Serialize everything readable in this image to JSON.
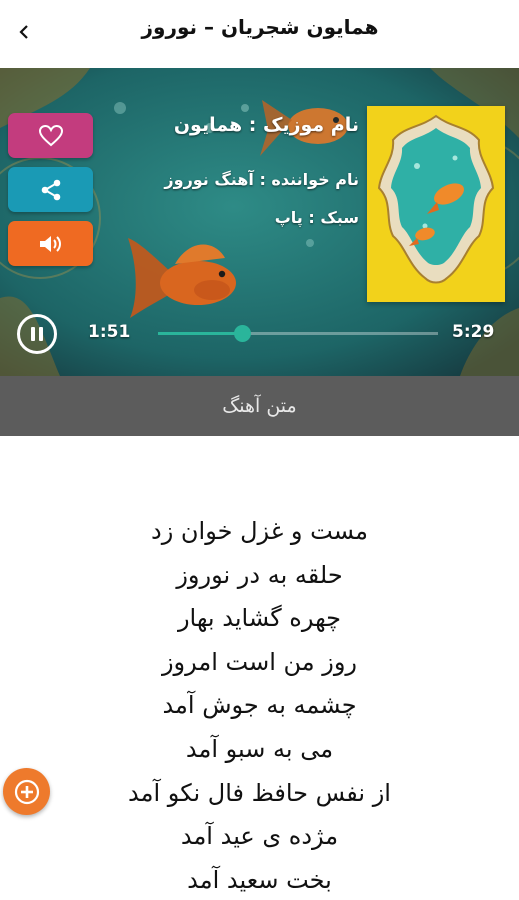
{
  "header": {
    "title": "همایون شجریان – نوروز",
    "back_icon": "chevron-left-icon"
  },
  "player": {
    "actions": [
      {
        "name": "like",
        "icon": "heart-icon",
        "color": "#c33c7e"
      },
      {
        "name": "share",
        "icon": "share-icon",
        "color": "#1a9ab5"
      },
      {
        "name": "volume",
        "icon": "speaker-icon",
        "color": "#ef6a22"
      }
    ],
    "info": {
      "music_name": "نام موزیک : همایون",
      "singer": "نام خواننده : آهنگ نوروز",
      "genre": "سبک : پاپ"
    },
    "time_current": "1:51",
    "time_total": "5:29",
    "progress": 0.3,
    "state_icon": "pause-icon",
    "accent": "#2ab59b"
  },
  "lyrics_tab": {
    "label": "متن آهنگ"
  },
  "lyrics": [
    "مست و غزل خوان زد",
    "حلقه به در نوروز",
    "چهره گشاید بهار",
    "روز من است امروز",
    "چشمه به جوش آمد",
    "می به سبو آمد",
    "از نفس حافظ فال نکو آمد",
    "مژده ی عید آمد",
    "بخت سعید آمد"
  ],
  "fab": {
    "icon": "plus-icon",
    "color": "#ee7a2c"
  }
}
